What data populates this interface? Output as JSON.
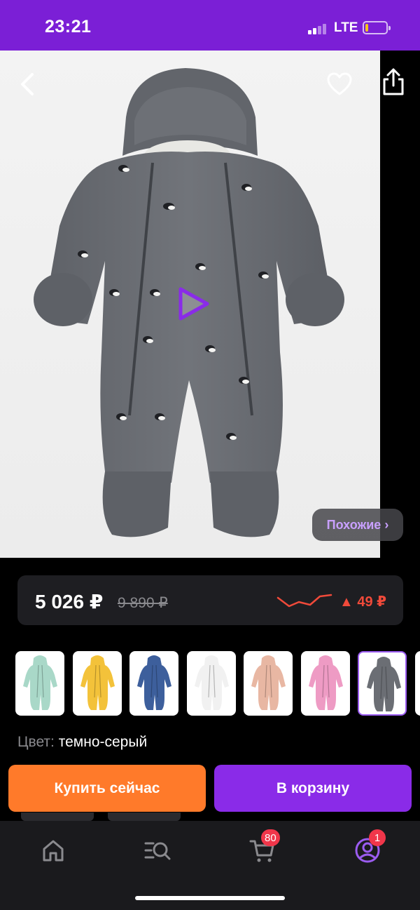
{
  "status_bar": {
    "time": "23:21",
    "network": "LTE",
    "battery_level": 0.15,
    "battery_color": "#f5c518"
  },
  "product": {
    "image_icon": "snowsuit-penguin-print-photo",
    "play_icon": "play-icon",
    "similar_label": "Похожие ›"
  },
  "header": {
    "back_icon": "chevron-left-icon",
    "favorite_icon": "heart-outline-icon",
    "share_icon": "share-icon"
  },
  "price": {
    "current": "5 026 ₽",
    "old": "9 890 ₽",
    "change": "▲ 49 ₽",
    "trend_icon": "price-trend-sparkline",
    "change_color": "#f04a3a"
  },
  "color_options": [
    {
      "name": "mint",
      "color": "#a9d8c8"
    },
    {
      "name": "yellow",
      "color": "#f3c23a"
    },
    {
      "name": "blue",
      "color": "#3d5f9c"
    },
    {
      "name": "white",
      "color": "#f1f1f1"
    },
    {
      "name": "peach",
      "color": "#e8b7a3"
    },
    {
      "name": "pink",
      "color": "#ee9bc4"
    },
    {
      "name": "dark-grey",
      "color": "#6b6e74",
      "selected": true
    },
    {
      "name": "partial",
      "color": "#dcdcdc"
    }
  ],
  "color_info": {
    "label": "Цвет:",
    "value": "темно-серый"
  },
  "actions": {
    "buy_now": "Купить сейчас",
    "add_to_cart": "В корзину",
    "buy_color": "#ff7a2a",
    "cart_color": "#8a2be8"
  },
  "tabbar": {
    "home_icon": "home-icon",
    "catalog_icon": "catalog-search-icon",
    "cart_icon": "cart-icon",
    "cart_badge": "80",
    "profile_icon": "profile-icon",
    "profile_badge": "1",
    "accent": "#9b5cf0"
  }
}
